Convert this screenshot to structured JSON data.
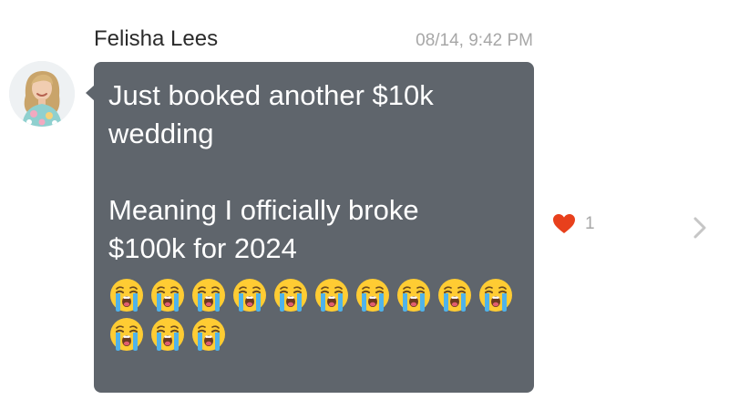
{
  "message": {
    "sender": "Felisha Lees",
    "timestamp": "08/14, 9:42 PM",
    "lines": [
      "Just booked another $10k",
      "wedding",
      "",
      "Meaning I officially broke",
      "$100k for 2024",
      ""
    ],
    "emoji": {
      "name": "loudly-crying-face-emoji",
      "row1_count": 10,
      "row2_count": 3
    },
    "reaction": {
      "icon": "heart-icon",
      "count": "1",
      "color": "#e8401c"
    }
  },
  "colors": {
    "bubble": "#5f656c",
    "timestamp": "#a7a7a7",
    "chevron": "#c6c6c6"
  }
}
